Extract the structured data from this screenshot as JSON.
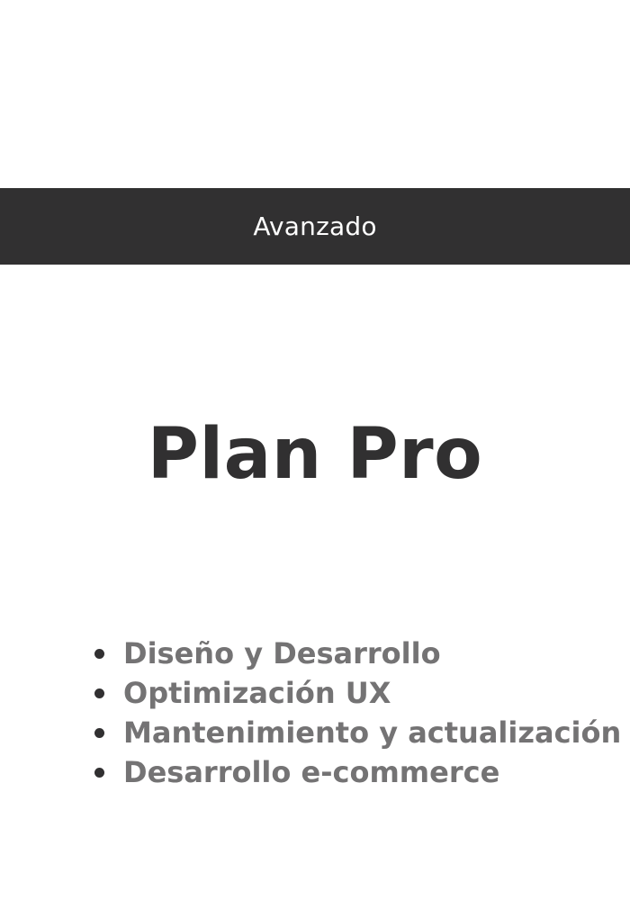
{
  "plan": {
    "tier": "Avanzado",
    "name": "Plan Pro",
    "features": [
      "Diseño y Desarrollo",
      "Optimización UX",
      "Mantenimiento y actualización",
      "Desarrollo e-commerce"
    ]
  },
  "colors": {
    "band": "#313031",
    "title": "#313031",
    "feature_text": "#747374",
    "background": "#ffffff"
  }
}
